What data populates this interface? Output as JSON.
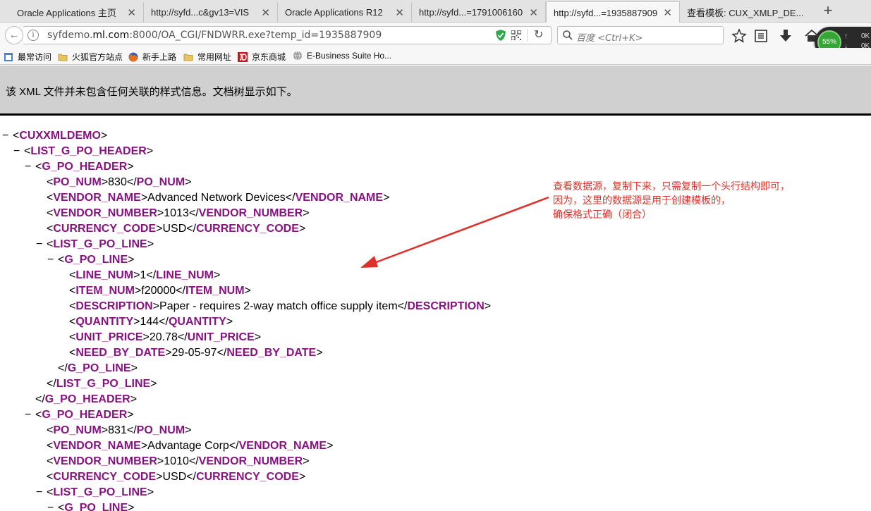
{
  "tabs": [
    {
      "title": "Oracle Applications 主页",
      "active": false
    },
    {
      "title": "http://syfd...c&gv13=VIS",
      "active": false
    },
    {
      "title": "Oracle Applications R12",
      "active": false
    },
    {
      "title": "http://syfd...=1791006160",
      "active": false
    },
    {
      "title": "http://syfd...=1935887909",
      "active": true
    },
    {
      "title": "查看模板: CUX_XMLP_DE...",
      "active": false
    }
  ],
  "tab_close_glyph": "✕",
  "new_tab_glyph": "+",
  "url": {
    "prefix": "syfdemo.",
    "host": "ml.com",
    "rest": ":8000/OA_CGI/FNDWRR.exe?temp_id=1935887909"
  },
  "search": {
    "placeholder": "百度 <Ctrl+K>"
  },
  "perf": {
    "percent": "55%",
    "up": "0K",
    "down": "0K"
  },
  "bookmarks": [
    {
      "label": "最常访问",
      "icon": "bookmarks-icon"
    },
    {
      "label": "火狐官方站点",
      "icon": "folder-icon"
    },
    {
      "label": "新手上路",
      "icon": "firefox-icon"
    },
    {
      "label": "常用网址",
      "icon": "folder-icon"
    },
    {
      "label": "京东商城",
      "icon": "jd-icon"
    },
    {
      "label": "E-Business Suite Ho...",
      "icon": "globe-icon"
    }
  ],
  "notice": "该 XML 文件并未包含任何关联的样式信息。文档树显示如下。",
  "xml_lines": [
    {
      "toggle": "−",
      "open": "CUXXMLDEMO"
    },
    {
      "toggle": "−",
      "open": "LIST_G_PO_HEADER"
    },
    {
      "toggle": "−",
      "open": "G_PO_HEADER"
    },
    {
      "tag": "PO_NUM",
      "value": "830"
    },
    {
      "tag": "VENDOR_NAME",
      "value": "Advanced Network Devices"
    },
    {
      "tag": "VENDOR_NUMBER",
      "value": "1013"
    },
    {
      "tag": "CURRENCY_CODE",
      "value": "USD"
    },
    {
      "toggle": "−",
      "open": "LIST_G_PO_LINE"
    },
    {
      "toggle": "−",
      "open": "G_PO_LINE"
    },
    {
      "tag": "LINE_NUM",
      "value": "1"
    },
    {
      "tag": "ITEM_NUM",
      "value": "f20000"
    },
    {
      "tag": "DESCRIPTION",
      "value": "Paper - requires 2-way match office supply item"
    },
    {
      "tag": "QUANTITY",
      "value": "144"
    },
    {
      "tag": "UNIT_PRICE",
      "value": "20.78"
    },
    {
      "tag": "NEED_BY_DATE",
      "value": "29-05-97"
    },
    {
      "close": "G_PO_LINE"
    },
    {
      "close": "LIST_G_PO_LINE"
    },
    {
      "close": "G_PO_HEADER"
    },
    {
      "toggle": "−",
      "open": "G_PO_HEADER"
    },
    {
      "tag": "PO_NUM",
      "value": "831"
    },
    {
      "tag": "VENDOR_NAME",
      "value": "Advantage Corp"
    },
    {
      "tag": "VENDOR_NUMBER",
      "value": "1010"
    },
    {
      "tag": "CURRENCY_CODE",
      "value": "USD"
    },
    {
      "toggle": "−",
      "open": "LIST_G_PO_LINE"
    },
    {
      "toggle": "−",
      "open": "G_PO_LINE"
    }
  ],
  "annotation": [
    "查看数据源，复制下来，只需复制一个头行结构即可，",
    "因为，这里的数据源是用于创建模板的，",
    "确保格式正确（闭合）"
  ],
  "colors": {
    "tag": "#881280",
    "annotation": "#e0302a",
    "notice_bg": "#d0d0d0"
  }
}
